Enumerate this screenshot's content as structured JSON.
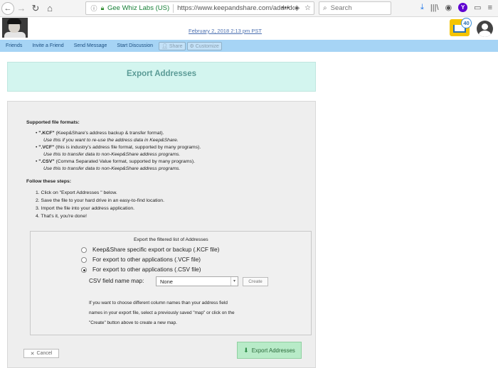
{
  "browser": {
    "secure_label": "Gee Whiz Labs (US)",
    "url": "https://www.keepandshare.com/addr/do",
    "search_placeholder": "Search"
  },
  "header": {
    "datetime": "February 2, 2018 2:13 pm PST",
    "inbox_count": "40"
  },
  "nav": {
    "items": [
      "Friends",
      "Invite a Friend",
      "Send Message",
      "Start Discussion"
    ],
    "share_label": "Share",
    "customize_label": "Customize"
  },
  "page": {
    "title": "Export Addresses",
    "formats_heading": "Supported file formats:",
    "formats": [
      {
        "name": "\".KCF\"",
        "desc": " (Keep&Share's address backup & transfer format).",
        "note": "Use this if you want to re-use the address data in Keep&Share."
      },
      {
        "name": "\".VCF\"",
        "desc": " (this is industry's address file format, supported by many programs).",
        "note": "Use this to transfer data to non-Keep&Share address programs."
      },
      {
        "name": "\".CSV\"",
        "desc": " (Comma Separated Value format, supported by many programs).",
        "note": "Use this to transfer data to non-Keep&Share address programs."
      }
    ],
    "steps_heading": "Follow these steps:",
    "steps": [
      "1. Click on \"Export Addresses \" below.",
      "2. Save the file to your hard drive in an easy-to-find location.",
      "3. Import the file into your address application.",
      "4. That's it, you're done!"
    ]
  },
  "export_box": {
    "heading": "Export the filtered list of Addresses",
    "options": [
      {
        "label": "Keep&Share specific export or backup (.KCF file)",
        "checked": false
      },
      {
        "label": "For export to other applications (.VCF file)",
        "checked": false
      },
      {
        "label": "For export to other applications (.CSV file)",
        "checked": true
      }
    ],
    "map_label": "CSV field name map:",
    "map_value": "None",
    "create_label": "Create",
    "help": [
      "If you want to choose different column names than your address field",
      "names in your export file, select a previously saved \"map\" or click on the",
      "\"Create\" button above to create a new map."
    ]
  },
  "actions": {
    "cancel_label": "Cancel",
    "export_label": "Export Addresses"
  }
}
